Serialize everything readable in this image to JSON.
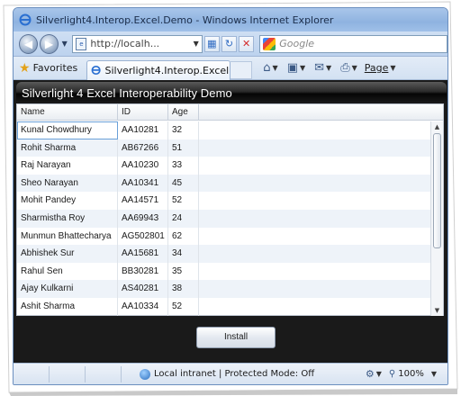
{
  "window": {
    "title": "Silverlight4.Interop.Excel.Demo - Windows Internet Explorer"
  },
  "address": {
    "url": "http://localh...",
    "search_placeholder": "Google"
  },
  "tabs": {
    "favorites_label": "Favorites",
    "active_tab": "Silverlight4.Interop.Excel...",
    "page_menu": "Page"
  },
  "app": {
    "title": "Silverlight 4 Excel Interoperability Demo",
    "columns": [
      "Name",
      "ID",
      "Age"
    ],
    "rows": [
      [
        "Kunal Chowdhury",
        "AA10281",
        "32"
      ],
      [
        "Rohit Sharma",
        "AB67266",
        "51"
      ],
      [
        "Raj Narayan",
        "AA10230",
        "33"
      ],
      [
        "Sheo Narayan",
        "AA10341",
        "45"
      ],
      [
        "Mohit Pandey",
        "AA14571",
        "52"
      ],
      [
        "Sharmistha Roy",
        "AA69943",
        "24"
      ],
      [
        "Munmun Bhattecharya",
        "AG502801",
        "62"
      ],
      [
        "Abhishek Sur",
        "AA15681",
        "34"
      ],
      [
        "Rahul Sen",
        "BB30281",
        "35"
      ],
      [
        "Ajay Kulkarni",
        "AS40281",
        "38"
      ],
      [
        "Ashit Sharma",
        "AA10334",
        "52"
      ]
    ],
    "install_label": "Install"
  },
  "status": {
    "zone_text": "Local intranet | Protected Mode: Off",
    "zoom": "100%"
  }
}
